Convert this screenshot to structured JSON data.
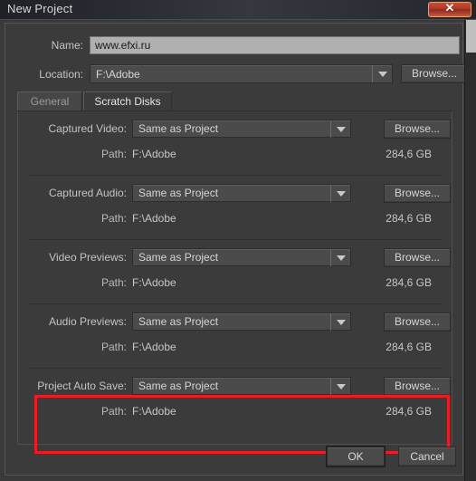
{
  "window": {
    "title": "New Project",
    "close_label": "✕"
  },
  "fields": {
    "name_label": "Name:",
    "name_value": "www.efxi.ru",
    "name_placeholder": "",
    "location_label": "Location:",
    "location_value": "F:\\Adobe",
    "location_browse": "Browse..."
  },
  "tabs": [
    {
      "label": "General",
      "active": false
    },
    {
      "label": "Scratch Disks",
      "active": true
    }
  ],
  "scratch_rows": [
    {
      "label": "Captured Video:",
      "value": "Same as Project",
      "browse": "Browse...",
      "path_label": "Path:",
      "path_value": "F:\\Adobe",
      "size": "284,6 GB",
      "highlighted": false
    },
    {
      "label": "Captured Audio:",
      "value": "Same as Project",
      "browse": "Browse...",
      "path_label": "Path:",
      "path_value": "F:\\Adobe",
      "size": "284,6 GB",
      "highlighted": false
    },
    {
      "label": "Video Previews:",
      "value": "Same as Project",
      "browse": "Browse...",
      "path_label": "Path:",
      "path_value": "F:\\Adobe",
      "size": "284,6 GB",
      "highlighted": false
    },
    {
      "label": "Audio Previews:",
      "value": "Same as Project",
      "browse": "Browse...",
      "path_label": "Path:",
      "path_value": "F:\\Adobe",
      "size": "284,6 GB",
      "highlighted": false
    },
    {
      "label": "Project Auto Save:",
      "value": "Same as Project",
      "browse": "Browse...",
      "path_label": "Path:",
      "path_value": "F:\\Adobe",
      "size": "284,6 GB",
      "highlighted": true
    }
  ],
  "footer": {
    "ok_label": "OK",
    "cancel_label": "Cancel"
  },
  "colors": {
    "highlight": "#ec1c24",
    "dialog_bg": "#3b3b3b",
    "close_red": "#b33a28",
    "input_focus_bg": "#b0b0b0"
  }
}
